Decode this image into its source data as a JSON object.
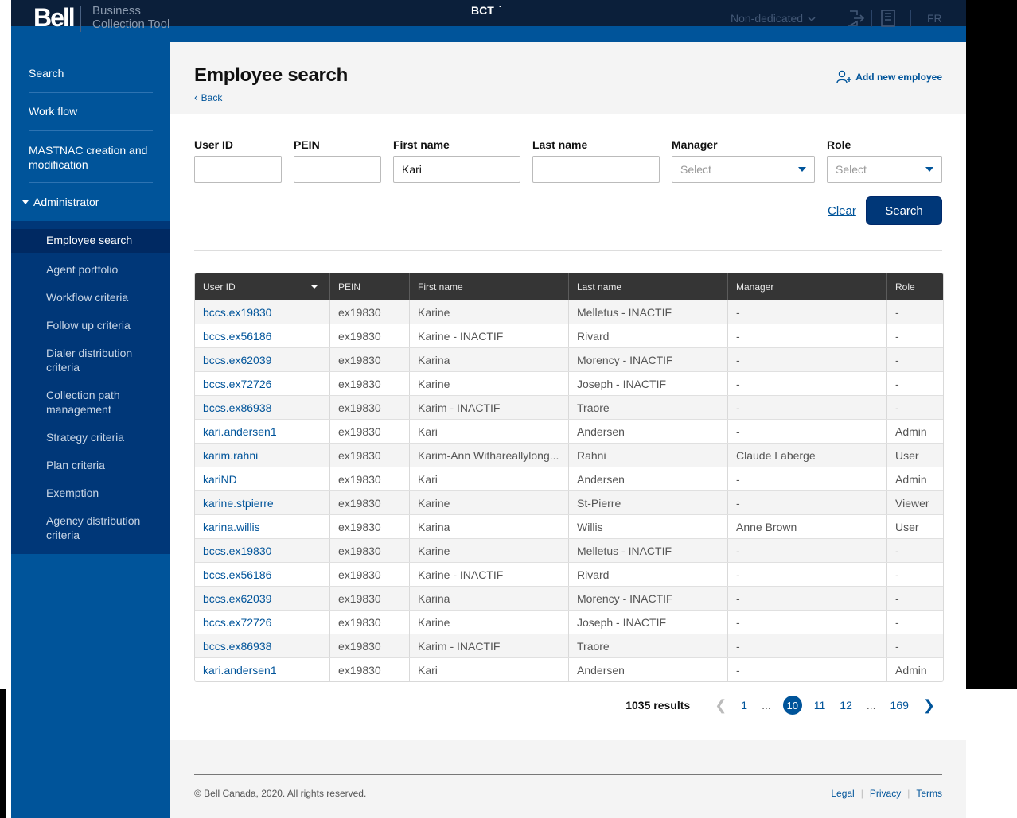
{
  "header": {
    "logo": "Bell",
    "app_name_line1": "Business",
    "app_name_line2": "Collection Tool",
    "brand": "BCT",
    "mode": "Non-dedicated",
    "lang": "FR"
  },
  "sidebar": {
    "items": [
      {
        "label": "Search"
      },
      {
        "label": "Work flow"
      },
      {
        "label": "MASTNAC creation and modification"
      }
    ],
    "admin_label": "Administrator",
    "sub_items": [
      {
        "label": "Employee search"
      },
      {
        "label": "Agent portfolio"
      },
      {
        "label": "Workflow criteria"
      },
      {
        "label": "Follow up criteria"
      },
      {
        "label": "Dialer distribution criteria"
      },
      {
        "label": "Collection path management"
      },
      {
        "label": "Strategy criteria"
      },
      {
        "label": "Plan criteria"
      },
      {
        "label": "Exemption"
      },
      {
        "label": "Agency distribution criteria"
      }
    ]
  },
  "page": {
    "title": "Employee search",
    "back": "Back",
    "add_employee": "Add new employee"
  },
  "form": {
    "user_id_label": "User ID",
    "user_id_value": "",
    "pein_label": "PEIN",
    "pein_value": "",
    "first_name_label": "First name",
    "first_name_value": "Kari",
    "last_name_label": "Last name",
    "last_name_value": "",
    "manager_label": "Manager",
    "manager_value": "Select",
    "role_label": "Role",
    "role_value": "Select",
    "clear": "Clear",
    "search": "Search"
  },
  "table": {
    "headers": [
      "User ID",
      "PEIN",
      "First name",
      "Last name",
      "Manager",
      "Role"
    ],
    "rows": [
      [
        "bccs.ex19830",
        "ex19830",
        "Karine",
        "Melletus - INACTIF",
        "-",
        "-"
      ],
      [
        "bccs.ex56186",
        "ex19830",
        "Karine - INACTIF",
        "Rivard",
        "-",
        "-"
      ],
      [
        "bccs.ex62039",
        "ex19830",
        "Karina",
        "Morency - INACTIF",
        "-",
        "-"
      ],
      [
        "bccs.ex72726",
        "ex19830",
        "Karine",
        "Joseph - INACTIF",
        "-",
        "-"
      ],
      [
        "bccs.ex86938",
        "ex19830",
        "Karim - INACTIF",
        "Traore",
        "-",
        "-"
      ],
      [
        "kari.andersen1",
        "ex19830",
        "Kari",
        "Andersen",
        "-",
        "Admin"
      ],
      [
        "karim.rahni",
        "ex19830",
        "Karim-Ann Withareallylong...",
        "Rahni",
        "Claude Laberge",
        "User"
      ],
      [
        "kariND",
        "ex19830",
        "Kari",
        "Andersen",
        "-",
        "Admin"
      ],
      [
        "karine.stpierre",
        "ex19830",
        "Karine",
        "St-Pierre",
        "-",
        "Viewer"
      ],
      [
        "karina.willis",
        "ex19830",
        "Karina",
        "Willis",
        "Anne Brown",
        "User"
      ],
      [
        "bccs.ex19830",
        "ex19830",
        "Karine",
        "Melletus - INACTIF",
        "-",
        "-"
      ],
      [
        "bccs.ex56186",
        "ex19830",
        "Karine - INACTIF",
        "Rivard",
        "-",
        "-"
      ],
      [
        "bccs.ex62039",
        "ex19830",
        "Karina",
        "Morency - INACTIF",
        "-",
        "-"
      ],
      [
        "bccs.ex72726",
        "ex19830",
        "Karine",
        "Joseph - INACTIF",
        "-",
        "-"
      ],
      [
        "bccs.ex86938",
        "ex19830",
        "Karim - INACTIF",
        "Traore",
        "-",
        "-"
      ],
      [
        "kari.andersen1",
        "ex19830",
        "Kari",
        "Andersen",
        "-",
        "Admin"
      ]
    ]
  },
  "pagination": {
    "results": "1035 results",
    "pages": [
      "1",
      "...",
      "10",
      "11",
      "12",
      "...",
      "169"
    ],
    "current": "10"
  },
  "footer": {
    "copyright": "© Bell Canada, 2020. All rights reserved.",
    "links": [
      "Legal",
      "Privacy",
      "Terms"
    ]
  },
  "colors": {
    "brand_blue": "#00549a",
    "dark_navy": "#003778",
    "header_dark": "#0b1f3a",
    "table_header": "#353535"
  }
}
